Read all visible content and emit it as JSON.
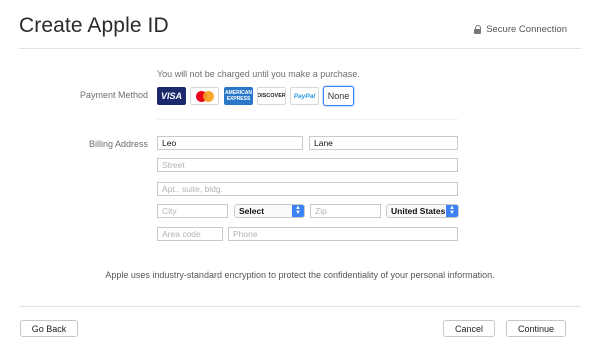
{
  "header": {
    "title": "Create Apple ID",
    "secure_label": "Secure Connection"
  },
  "payment": {
    "note": "You will not be charged until you make a purchase.",
    "label": "Payment Method",
    "cards": [
      {
        "name": "VISA",
        "text": "VISA"
      },
      {
        "name": "MasterCard",
        "text": "mastercard"
      },
      {
        "name": "American Express",
        "text": "AMERICAN EXPRESS"
      },
      {
        "name": "Discover",
        "text": "DISCOVER"
      },
      {
        "name": "PayPal",
        "text": "PayPal"
      }
    ],
    "none_label": "None",
    "selected": "None"
  },
  "billing": {
    "label": "Billing Address",
    "first_name": "Leo",
    "last_name": "Lane",
    "street_placeholder": "Street",
    "apt_placeholder": "Apt., suite, bldg.",
    "city_placeholder": "City",
    "state_value": "Select",
    "zip_placeholder": "Zip",
    "country_value": "United States",
    "area_code_placeholder": "Area code",
    "phone_placeholder": "Phone"
  },
  "footer": {
    "encryption_note": "Apple uses industry-standard encryption to protect the confidentiality of your personal information.",
    "back_label": "Go Back",
    "cancel_label": "Cancel",
    "continue_label": "Continue"
  },
  "colors": {
    "accent": "#3b82f6",
    "visa": "#1a2a6c",
    "amex": "#2a78c8"
  }
}
